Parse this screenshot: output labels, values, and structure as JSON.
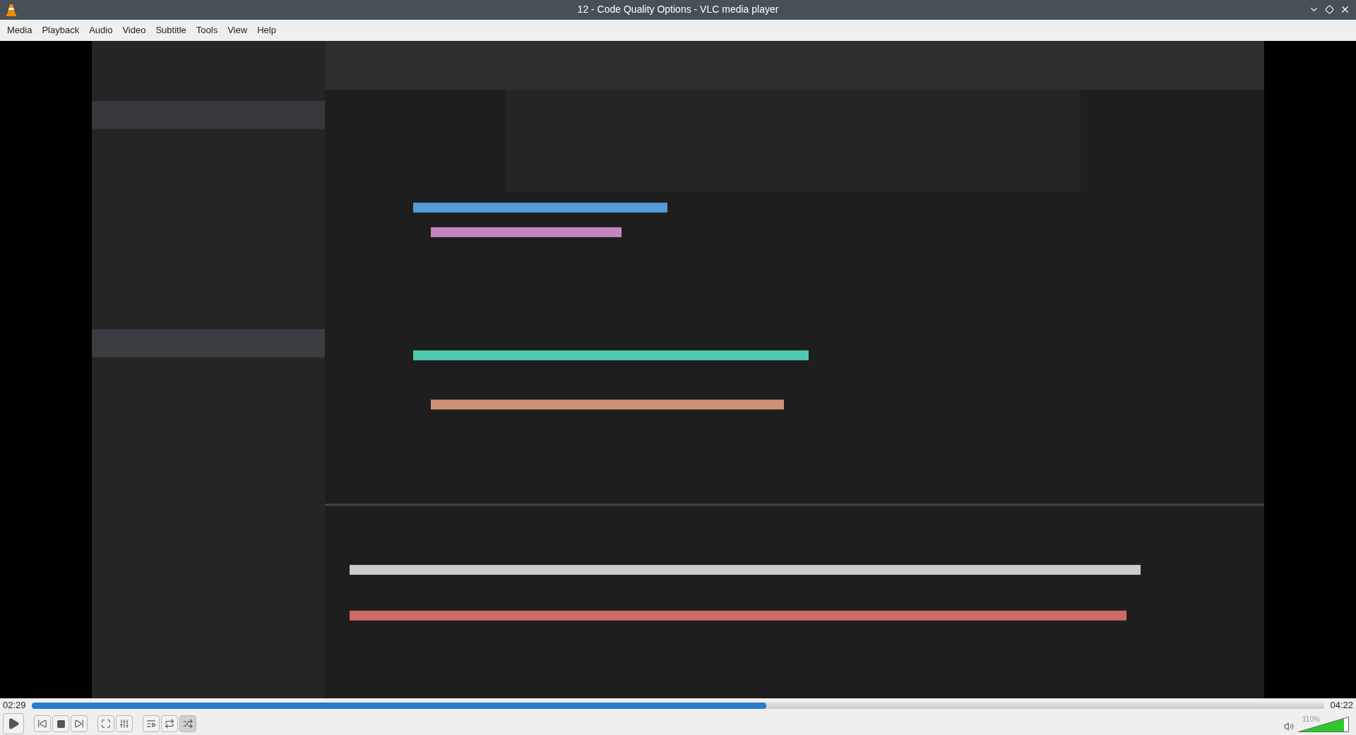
{
  "window": {
    "title": "12 - Code Quality Options - VLC media player"
  },
  "menu": [
    "Media",
    "Playback",
    "Audio",
    "Video",
    "Subtitle",
    "Tools",
    "View",
    "Help"
  ],
  "video": {
    "kind": "picture"
  },
  "seek": {
    "elapsed": "02:29",
    "total": "04:22",
    "level": 0.568
  },
  "controls": [
    {
      "kind": "play"
    },
    {
      "kind": "prev"
    },
    {
      "kind": "stop"
    },
    {
      "kind": "next"
    },
    {
      "kind": "fullscreen"
    },
    {
      "kind": "settings"
    },
    {
      "kind": "playlist"
    },
    {
      "kind": "loop",
      "on": false
    },
    {
      "kind": "random",
      "on": true
    }
  ],
  "volume": {
    "reading": "110%",
    "level": 0.9
  }
}
